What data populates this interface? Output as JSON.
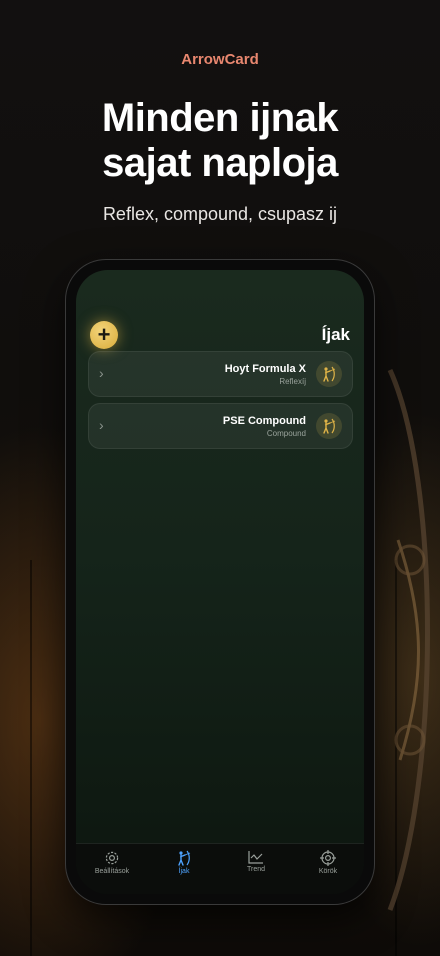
{
  "header": {
    "brand": "ArrowCard",
    "headline_line1": "Minden ijnak",
    "headline_line2": "sajat naploja",
    "subline": "Reflex, compound, csupasz ij"
  },
  "screen": {
    "title": "Íjak",
    "add_button_label": "+",
    "bows": [
      {
        "name": "Hoyt Formula X",
        "type": "Reflexíj",
        "icon": "archer-icon"
      },
      {
        "name": "PSE Compound",
        "type": "Compound",
        "icon": "archer-icon"
      }
    ]
  },
  "tabbar": {
    "tabs": [
      {
        "label": "Beállítások",
        "icon": "gear-icon",
        "active": false
      },
      {
        "label": "Íjak",
        "icon": "archer-icon",
        "active": true
      },
      {
        "label": "Trend",
        "icon": "trend-chart-icon",
        "active": false
      },
      {
        "label": "Körök",
        "icon": "target-icon",
        "active": false
      }
    ]
  },
  "colors": {
    "brand": "#e8876f",
    "accent_gold": "#e0b448",
    "tab_active": "#4ea3ff",
    "screen_bg": "#15241a"
  }
}
